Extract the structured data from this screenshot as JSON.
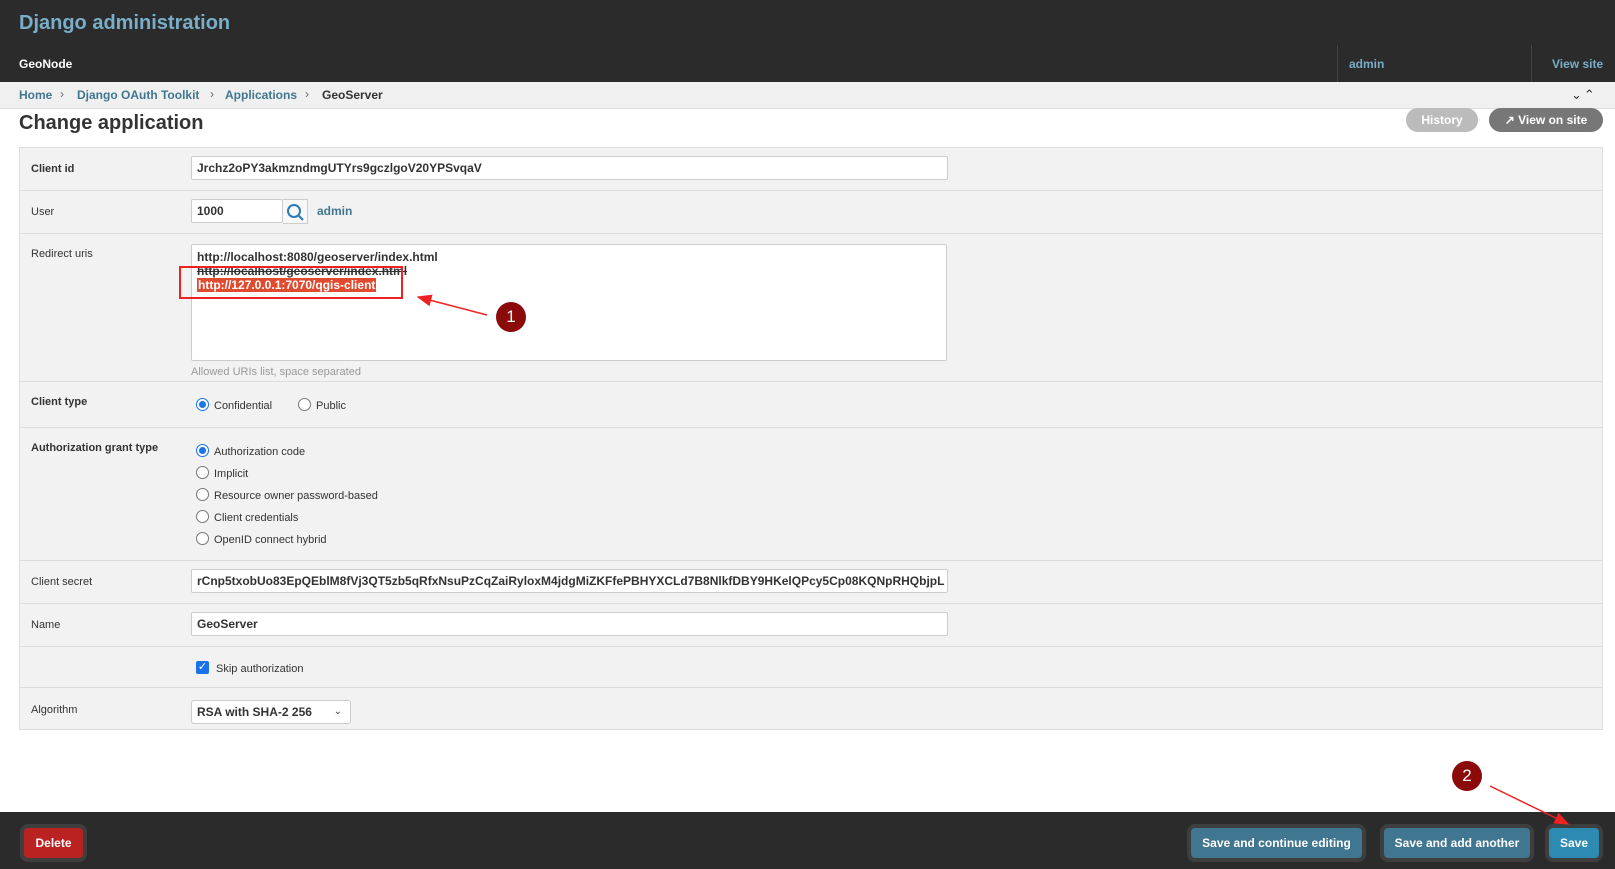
{
  "header": {
    "site_title": "Django administration",
    "brand": "GeoNode",
    "user": "admin",
    "view_site": "View site"
  },
  "breadcrumbs": [
    "Home",
    "Django OAuth Toolkit",
    "Applications",
    "GeoServer"
  ],
  "page": {
    "title": "Change application",
    "history_label": "History",
    "view_on_site_label": "View on site"
  },
  "form": {
    "client_id": {
      "label": "Client id",
      "value": "Jrchz2oPY3akmzndmgUTYrs9gczlgoV20YPSvqaV"
    },
    "user": {
      "label": "User",
      "value": "1000",
      "related_label": "admin"
    },
    "redirect_uris": {
      "label": "Redirect uris",
      "lines": [
        "http://localhost:8080/geoserver/index.html",
        "http://localhost/geoserver/index.html",
        "http://127.0.0.1:7070/qgis-client"
      ],
      "help": "Allowed URIs list, space separated"
    },
    "client_type": {
      "label": "Client type",
      "options": [
        "Confidential",
        "Public"
      ],
      "selected": "Confidential"
    },
    "grant_type": {
      "label": "Authorization grant type",
      "options": [
        "Authorization code",
        "Implicit",
        "Resource owner password-based",
        "Client credentials",
        "OpenID connect hybrid"
      ],
      "selected": "Authorization code"
    },
    "client_secret": {
      "label": "Client secret",
      "value": "rCnp5txobUo83EpQEblM8fVj3QT5zb5qRfxNsuPzCqZaiRyloxM4jdgMiZKFfePBHYXCLd7B8NlkfDBY9HKelQPcy5Cp08KQNpRHQbjpL"
    },
    "name": {
      "label": "Name",
      "value": "GeoServer"
    },
    "skip_authorization": {
      "label": "Skip authorization",
      "checked": true
    },
    "algorithm": {
      "label": "Algorithm",
      "value": "RSA with SHA-2 256"
    }
  },
  "submit": {
    "delete": "Delete",
    "save_continue": "Save and continue editing",
    "save_another": "Save and add another",
    "save": "Save"
  },
  "annotations": {
    "badge1": "1",
    "badge2": "2"
  },
  "colors": {
    "header_bg": "#2b2b2b",
    "link": "#417690",
    "header_link": "#79aec8",
    "delete": "#ba2121",
    "save": "#2d8ab3",
    "annotation_red": "#e22222",
    "badge": "#8b0a0a"
  },
  "icons": {
    "lookup": "magnifier-icon",
    "collapse": "double-chevron-icons",
    "view_on_site": "external-arrow-icon",
    "select_caret": "chevron-down-icon",
    "checkbox": "checkmark-icon"
  }
}
